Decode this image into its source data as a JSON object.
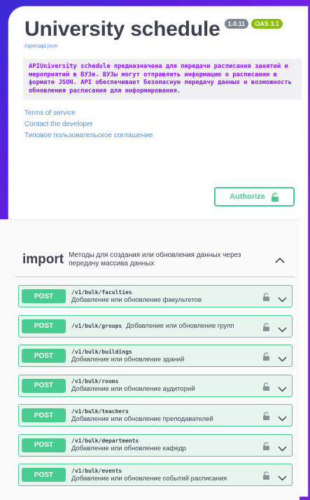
{
  "info": {
    "title": "University schedule",
    "version": "1.0.11",
    "oas": "OAS 3.1",
    "url": "/openapi.json",
    "description": "APIUniversity schedule предназначена для передачи расписания занятий и мероприятий в ВУЗе. ВУЗы могут отправлять информацию о расписании в формате JSON. API обеспечивает безопасную передачу данных и возможность обновления расписания для информирования.",
    "links": [
      "Terms of service",
      "Contact the developer",
      "Типовое пользовательское соглашение"
    ]
  },
  "authorize": {
    "label": "Authorize",
    "icon": "unlocked-lock-icon"
  },
  "tag": {
    "name": "import",
    "description": "Методы для создания или обновления данных через передачу массива данных",
    "expanded": true
  },
  "operations": [
    {
      "method": "POST",
      "path": "/v1/bulk/faculties",
      "summary": "Добавление или обновление факультетов"
    },
    {
      "method": "POST",
      "path": "/v1/bulk/groups",
      "summary": "Добавление или обновление групп"
    },
    {
      "method": "POST",
      "path": "/v1/bulk/buildings",
      "summary": "Добавление или обновление зданий"
    },
    {
      "method": "POST",
      "path": "/v1/bulk/rooms",
      "summary": "Добавление или обновление аудиторий"
    },
    {
      "method": "POST",
      "path": "/v1/bulk/teachers",
      "summary": "Добавление или обновление преподавателей"
    },
    {
      "method": "POST",
      "path": "/v1/bulk/departments",
      "summary": "Добавление или обновление кафедр"
    },
    {
      "method": "POST",
      "path": "/v1/bulk/events",
      "summary": "Добавление или обновление событий расписания"
    }
  ],
  "colors": {
    "accent": "#49cc90",
    "link": "#4990e2",
    "text": "#3b4151",
    "code": "#9012fe"
  }
}
